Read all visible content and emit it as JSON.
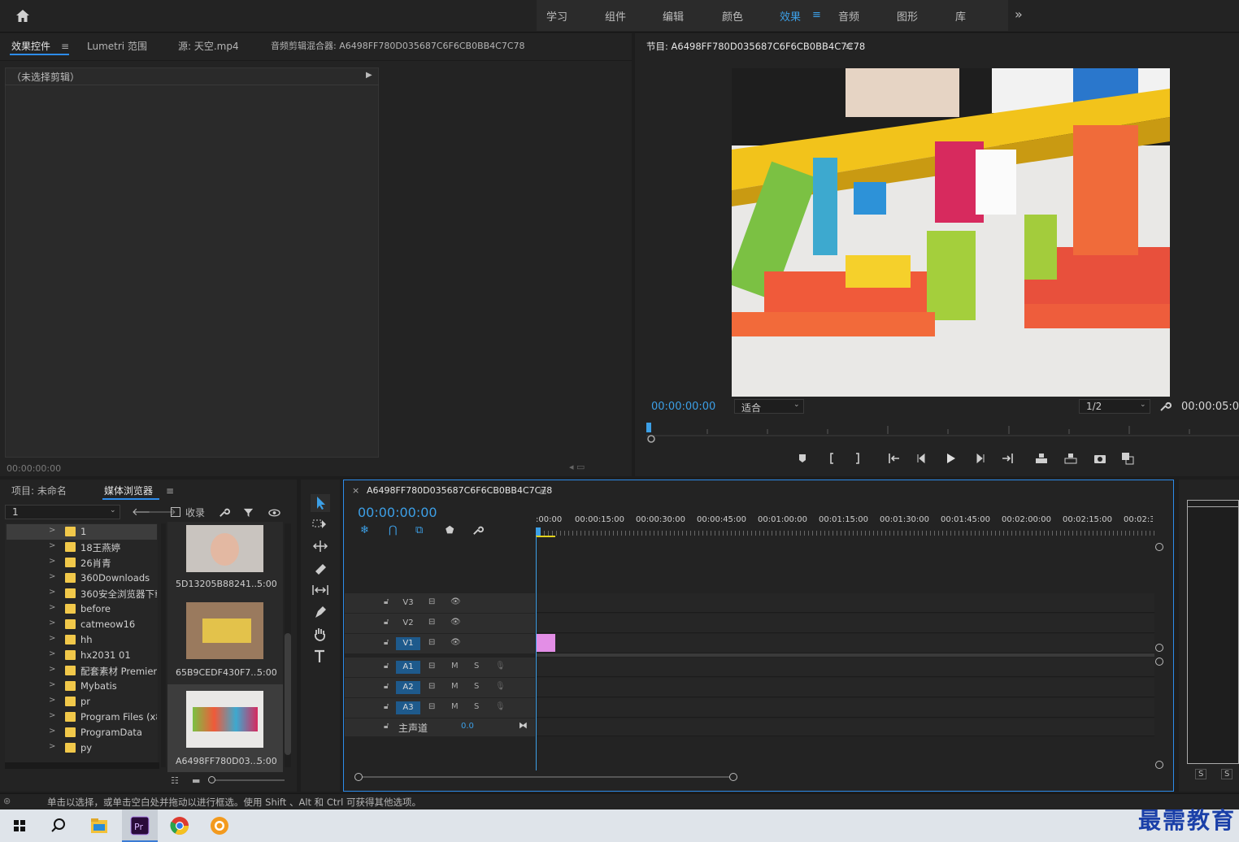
{
  "workspaces": {
    "items": [
      {
        "label": "学习",
        "active": false
      },
      {
        "label": "组件",
        "active": false
      },
      {
        "label": "编辑",
        "active": false
      },
      {
        "label": "颜色",
        "active": false
      },
      {
        "label": "效果",
        "active": true
      },
      {
        "label": "音频",
        "active": false
      },
      {
        "label": "图形",
        "active": false
      },
      {
        "label": "库",
        "active": false
      }
    ],
    "more": "»",
    "menu": "≡"
  },
  "source_panel": {
    "tabs": [
      "效果控件",
      "Lumetri 范围",
      "源: 天空.mp4",
      "音频剪辑混合器: A6498FF780D035687C6F6CB0BB4C7C78"
    ],
    "menu": "≡",
    "no_clip": "（未选择剪辑）",
    "timecode": "00:00:00:00"
  },
  "program_panel": {
    "title": "节目: A6498FF780D035687C6F6CB0BB4C7C78",
    "menu": "≡",
    "timecode": "00:00:00:00",
    "fit_label": "适合",
    "resolution": "1/2",
    "duration": "00:00:05:00"
  },
  "project_panel": {
    "tabs": [
      "项目: 未命名",
      "媒体浏览器"
    ],
    "menu": "≡",
    "drive": "1",
    "ingest": "收录",
    "folders": [
      "1",
      "18王燕婷",
      "26肖青",
      "360Downloads",
      "360安全浏览器下载",
      "before",
      "catmeow16",
      "hh",
      "hx2031 01",
      "配套素材 Premiere",
      "Mybatis",
      "pr",
      "Program Files (x86)",
      "ProgramData",
      "py"
    ],
    "thumbs": [
      {
        "name": "5D13205B88241...",
        "duration": "5:00"
      },
      {
        "name": "65B9CEDF430F7...",
        "duration": "5:00"
      },
      {
        "name": "A6498FF780D03...",
        "duration": "5:00"
      }
    ]
  },
  "timeline": {
    "title": "A6498FF780D035687C6F6CB0BB4C7C78",
    "close": "×",
    "menu": "≡",
    "timecode": "00:00:00:00",
    "ruler": [
      ":00:00",
      "00:00:15:00",
      "00:00:30:00",
      "00:00:45:00",
      "00:01:00:00",
      "00:01:15:00",
      "00:01:30:00",
      "00:01:45:00",
      "00:02:00:00",
      "00:02:15:00",
      "00:02:3"
    ],
    "video_tracks": [
      "V3",
      "V2",
      "V1"
    ],
    "audio_tracks": [
      "A1",
      "A2",
      "A3"
    ],
    "m": "M",
    "s": "S",
    "master": "主声道",
    "master_value": "0.0",
    "clip_color": "#e38ee6"
  },
  "status": "单击以选择，或单击空白处并拖动以进行框选。使用 Shift 、Alt 和 Ctrl 可获得其他选项。",
  "watermark": "最需教育",
  "audio_meter": {
    "s1": "S",
    "s2": "S"
  },
  "colors": {
    "accent": "#2d8ceb",
    "timecode": "#3c9fe6"
  }
}
